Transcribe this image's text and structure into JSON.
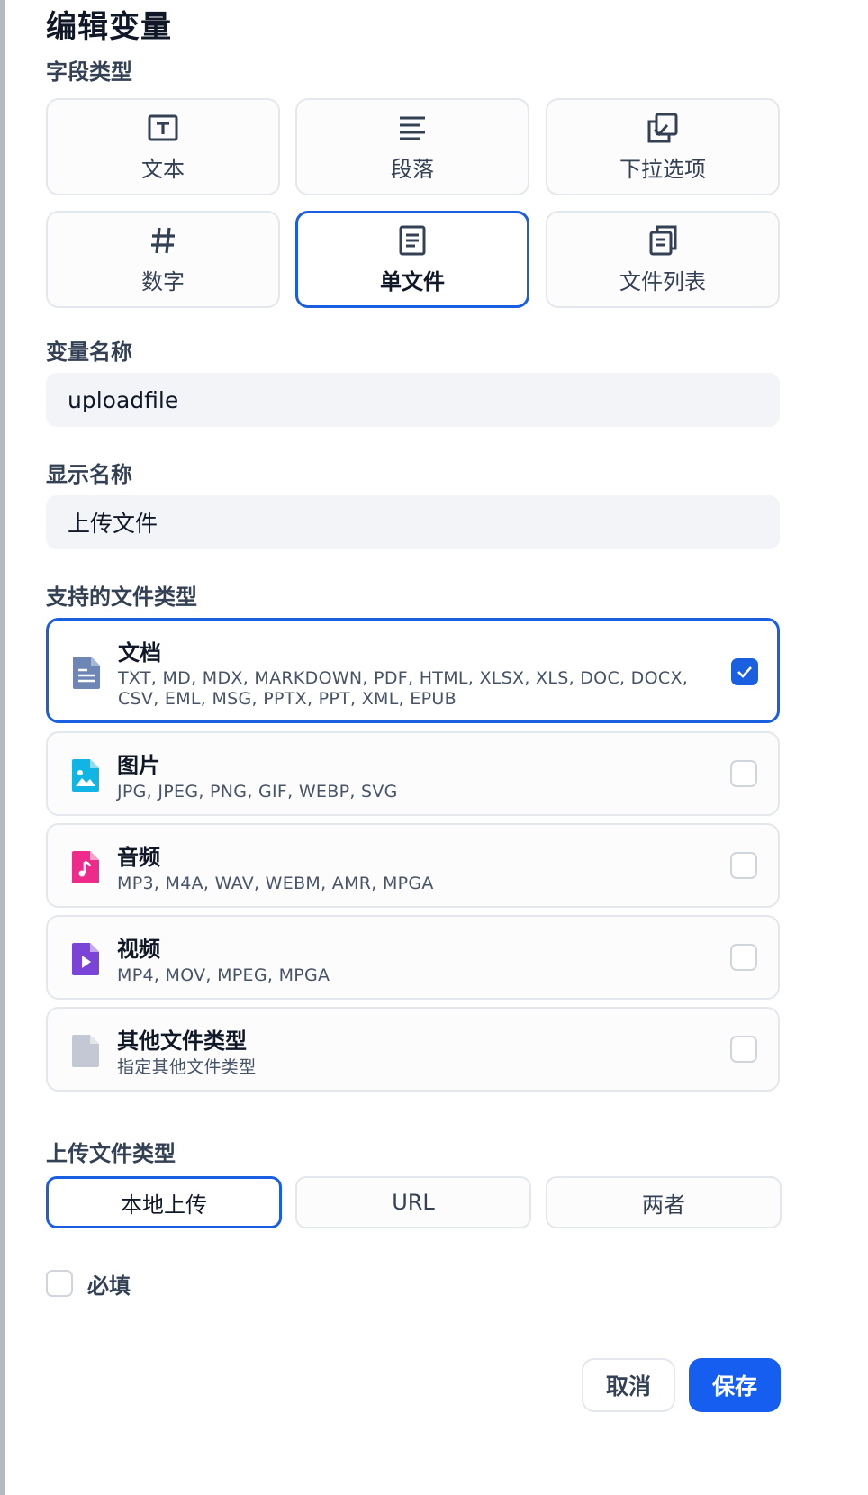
{
  "dialog": {
    "title": "编辑变量",
    "field_type_label": "字段类型",
    "field_types": [
      {
        "label": "文本",
        "icon": "text-input-icon",
        "selected": false
      },
      {
        "label": "段落",
        "icon": "paragraph-icon",
        "selected": false
      },
      {
        "label": "下拉选项",
        "icon": "select-icon",
        "selected": false
      },
      {
        "label": "数字",
        "icon": "hash-icon",
        "selected": false
      },
      {
        "label": "单文件",
        "icon": "file-icon",
        "selected": true
      },
      {
        "label": "文件列表",
        "icon": "file-list-icon",
        "selected": false
      }
    ],
    "variable_name_label": "变量名称",
    "variable_name_value": "uploadfile",
    "display_name_label": "显示名称",
    "display_name_value": "上传文件",
    "supported_types_label": "支持的文件类型",
    "file_types": [
      {
        "name": "文档",
        "extensions": "TXT, MD, MDX, MARKDOWN, PDF, HTML, XLSX, XLS, DOC, DOCX, CSV, EML, MSG, PPTX, PPT, XML, EPUB",
        "icon": "document-icon",
        "color": "#6e86b5",
        "checked": true
      },
      {
        "name": "图片",
        "extensions": "JPG, JPEG, PNG, GIF, WEBP, SVG",
        "icon": "image-icon",
        "color": "#11b5e4",
        "checked": false
      },
      {
        "name": "音频",
        "extensions": "MP3, M4A, WAV, WEBM, AMR, MPGA",
        "icon": "audio-icon",
        "color": "#ee2a8a",
        "checked": false
      },
      {
        "name": "视频",
        "extensions": "MP4, MOV, MPEG, MPGA",
        "icon": "video-icon",
        "color": "#7a45d6",
        "checked": false
      },
      {
        "name": "其他文件类型",
        "extensions": "指定其他文件类型",
        "icon": "other-file-icon",
        "color": "#c3c8d4",
        "checked": false
      }
    ],
    "upload_method_label": "上传文件类型",
    "upload_methods": [
      {
        "label": "本地上传",
        "selected": true
      },
      {
        "label": "URL",
        "selected": false
      },
      {
        "label": "两者",
        "selected": false
      }
    ],
    "required_label": "必填",
    "required_checked": false,
    "cancel_label": "取消",
    "save_label": "保存"
  },
  "colors": {
    "accent": "#1a5fe0",
    "save_button": "#155eef",
    "input_background": "#f2f4f7"
  }
}
